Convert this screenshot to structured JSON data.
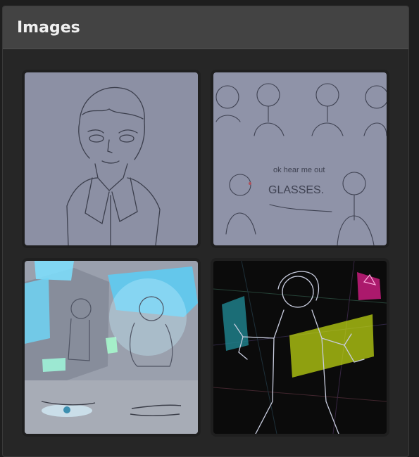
{
  "panel": {
    "title": "Images"
  },
  "images": [
    {
      "name": "sketch-portrait",
      "bg": "#8c90a4"
    },
    {
      "name": "character-sheet-sketches",
      "bg": "#8f93a8",
      "caption_line1": "ok hear me out",
      "caption_line2": "GLASSES."
    },
    {
      "name": "blue-hologram-scene",
      "bg": "#9aa0ad"
    },
    {
      "name": "neon-hologram-figure",
      "bg": "#0b0b0b"
    }
  ]
}
